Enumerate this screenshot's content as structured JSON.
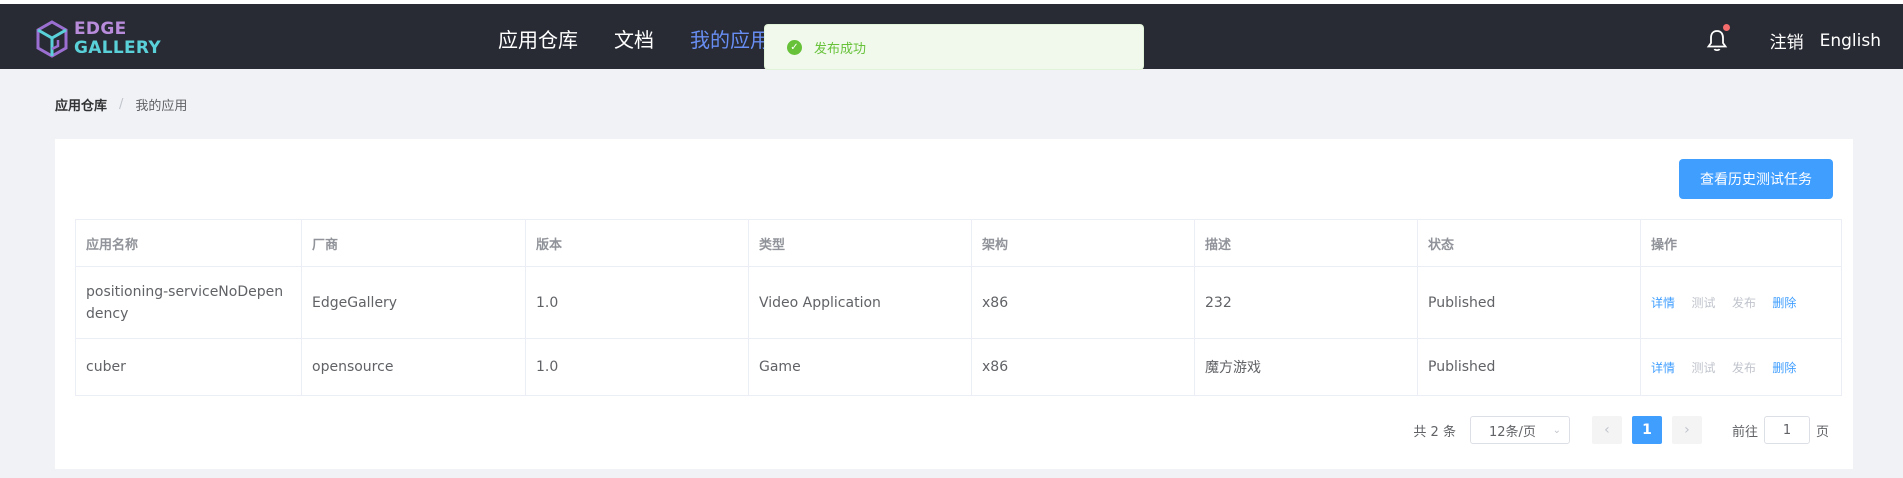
{
  "header": {
    "logo_line1": "EDGE",
    "logo_line2": "GALLERY",
    "nav": [
      {
        "label": "应用仓库"
      },
      {
        "label": "文档"
      },
      {
        "label": "我的应用"
      }
    ],
    "logout": "注销",
    "language": "English",
    "accent": "#688ef3"
  },
  "toast": {
    "message": "发布成功",
    "color": "#67c23a"
  },
  "breadcrumb": {
    "root": "应用仓库",
    "separator": "/",
    "current": "我的应用"
  },
  "actions": {
    "history_button": "查看历史测试任务"
  },
  "table": {
    "columns": [
      "应用名称",
      "厂商",
      "版本",
      "类型",
      "架构",
      "描述",
      "状态",
      "操作"
    ],
    "rows": [
      {
        "name": "positioning-serviceNoDependency",
        "vendor": "EdgeGallery",
        "version": "1.0",
        "type": "Video Application",
        "arch": "x86",
        "desc": "232",
        "status": "Published"
      },
      {
        "name": "cuber",
        "vendor": "opensource",
        "version": "1.0",
        "type": "Game",
        "arch": "x86",
        "desc": "魔方游戏",
        "status": "Published"
      }
    ],
    "ops": {
      "detail": "详情",
      "test": "测试",
      "publish": "发布",
      "delete": "删除"
    }
  },
  "pagination": {
    "total": "共 2 条",
    "page_size": "12条/页",
    "current_page": "1",
    "goto_prefix": "前往",
    "goto_value": "1",
    "goto_suffix": "页"
  },
  "colors": {
    "primary": "#409eff",
    "header_bg": "#282b33",
    "page_bg": "#f0f2f5"
  }
}
